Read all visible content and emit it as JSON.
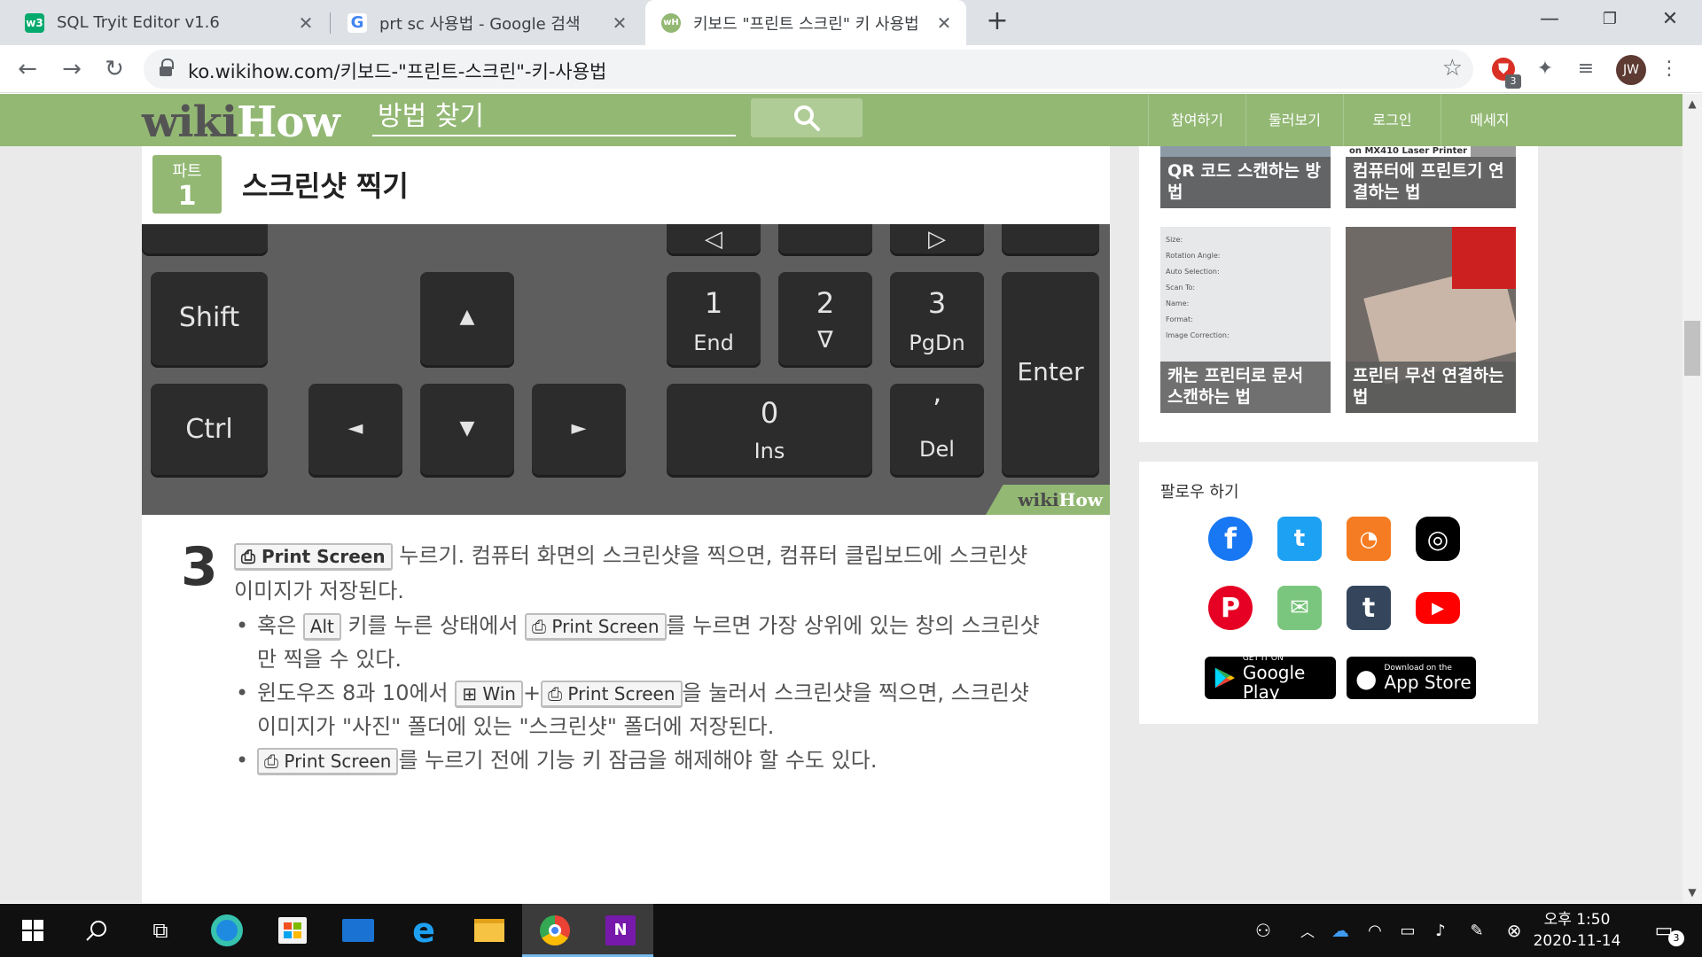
{
  "browser": {
    "tabs": [
      {
        "title": "SQL Tryit Editor v1.6",
        "favicon": "w3schools-icon",
        "favicon_color": "#04aa6d",
        "favicon_text": "w3"
      },
      {
        "title": "prt sc 사용법 - Google 검색",
        "favicon": "google-icon",
        "favicon_color": "#4285f4",
        "favicon_text": "G"
      },
      {
        "title": "키보드 \"프린트 스크린\" 키 사용법",
        "favicon": "wikihow-icon",
        "favicon_color": "#93b874",
        "favicon_text": "wH"
      }
    ],
    "url": "ko.wikihow.com/키보드-\"프린트-스크린\"-키-사용법",
    "extension_badge": "3",
    "profile_initials": "JW"
  },
  "wikihow": {
    "logo_wiki": "wiki",
    "logo_how": "How",
    "search_placeholder": "방법 찾기",
    "nav": [
      "참여하기",
      "둘러보기",
      "로그인",
      "메세지"
    ]
  },
  "article": {
    "part_label": "파트",
    "part_number": "1",
    "part_title": "스크린샷 찍기",
    "keyboard_image": {
      "keys": {
        "shift": "Shift",
        "ctrl": "Ctrl",
        "up": "▲",
        "left": "◄",
        "down": "▼",
        "right": "►",
        "k1_top": "1",
        "k1_bottom": "End",
        "k2_top": "2",
        "k2_bottom": "∇",
        "k3_top": "3",
        "k3_bottom": "PgDn",
        "k0_top": "0",
        "k0_bottom": "Ins",
        "kdot_top": "’",
        "kdot_bottom": "Del",
        "enter": "Enter",
        "top_left_arrow": "◁",
        "top_right_arrow": "▷"
      },
      "watermark_wiki": "wiki",
      "watermark_how": "How"
    },
    "step": {
      "number": "3",
      "key_label": "⎙ Print Screen",
      "text_after_key": " 누르기. 컴퓨터 화면의 스크린샷을 찍으면, 컴퓨터 클립보드에 스크린샷 이미지가 저장된다."
    },
    "bullets": [
      {
        "pre": "혹은 ",
        "key1": "Alt",
        "mid": " 키를 누른 상태에서 ",
        "key2": "⎙ Print Screen",
        "post": "를 누르면 가장 상위에 있는 창의 스크린샷만 찍을 수 있다."
      },
      {
        "pre": "윈도우즈 8과 10에서 ",
        "key1": "⊞ Win",
        "mid": "+",
        "key2": "⎙ Print Screen",
        "post": "을 눌러서 스크린샷을 찍으면, 스크린샷 이미지가 \"사진\" 폴더에 있는 \"스크린샷\" 폴더에 저장된다."
      },
      {
        "pre": "",
        "key1": "⎙ Print Screen",
        "mid": "",
        "key2": "",
        "post": "를 누르기 전에 기능 키 잠금을 해제해야 할 수도 있다."
      }
    ]
  },
  "sidebar": {
    "related": [
      {
        "label": "QR 코드 스캔하는 방법"
      },
      {
        "label": "컴퓨터에 프린트기 연결하는 법",
        "image_text": "on MX410 Laser Printer"
      },
      {
        "label": "캐논 프린터로 문서 스캔하는 법",
        "image_rows": [
          "Size:",
          "Rotation Angle:",
          "Auto Selection:",
          "Scan To:",
          "Name:",
          "Format:",
          "Image Correction:"
        ]
      },
      {
        "label": "프린터 무선 연결하는 법"
      }
    ],
    "follow_title": "팔로우 하기",
    "social": [
      {
        "name": "facebook-icon",
        "color": "#1877f2",
        "glyph": "f"
      },
      {
        "name": "twitter-icon",
        "color": "#1da1f2",
        "glyph": "t"
      },
      {
        "name": "rss-icon",
        "color": "#f57c22",
        "glyph": "◔"
      },
      {
        "name": "instagram-icon",
        "color": "#000000",
        "glyph": "◎"
      },
      {
        "name": "pinterest-icon",
        "color": "#e60023",
        "glyph": "P"
      },
      {
        "name": "email-icon",
        "color": "#7bc67e",
        "glyph": "✉"
      },
      {
        "name": "tumblr-icon",
        "color": "#35465c",
        "glyph": "t"
      },
      {
        "name": "youtube-icon",
        "color": "#ff0000",
        "glyph": "▶"
      }
    ],
    "google_play_small": "GET IT ON",
    "google_play_big": "Google Play",
    "app_store_small": "Download on the",
    "app_store_big": "App Store"
  },
  "taskbar": {
    "clock_time": "오후 1:50",
    "clock_date": "2020-11-14",
    "notification_count": "3"
  }
}
